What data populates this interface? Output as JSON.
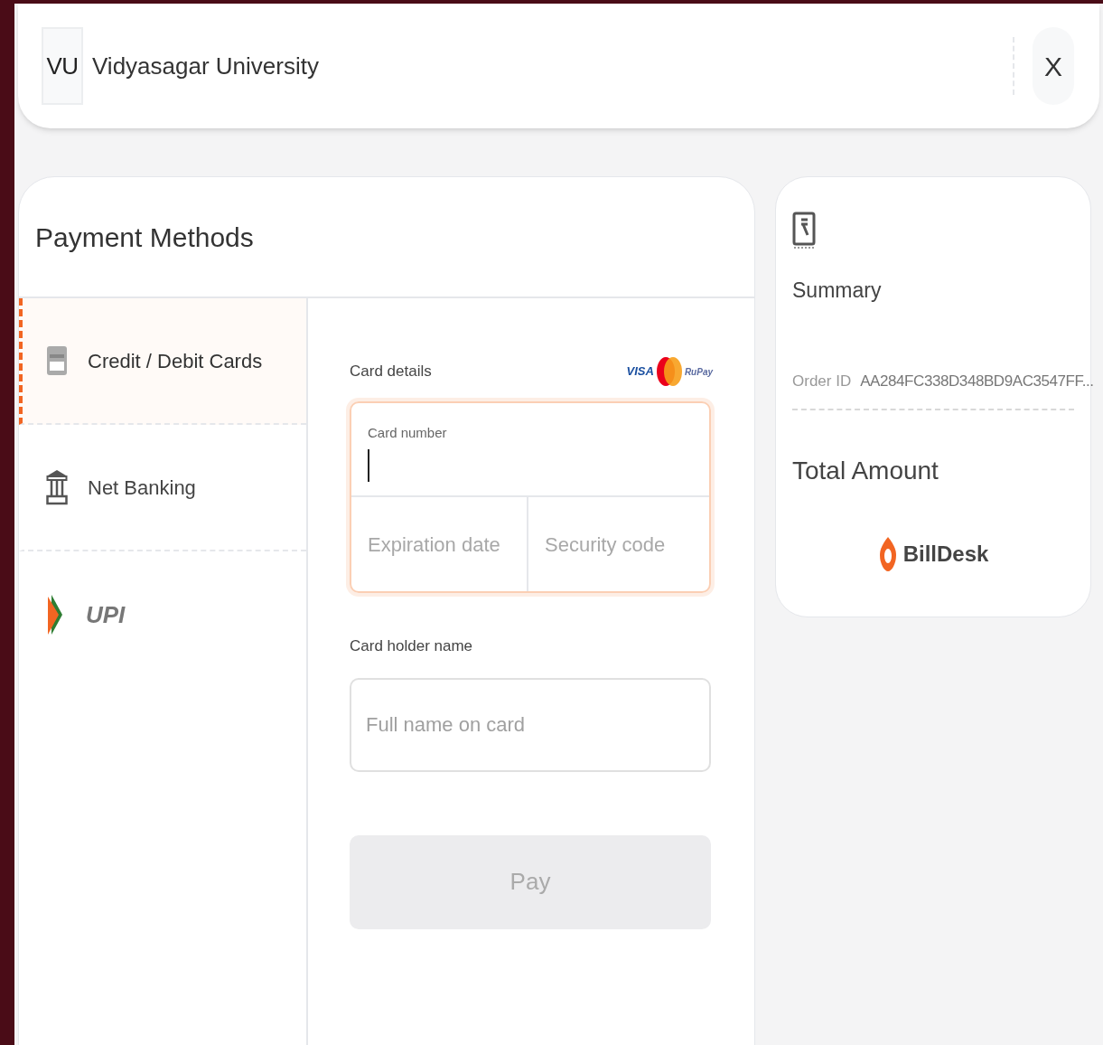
{
  "header": {
    "initials": "VU",
    "title": "Vidyasagar University",
    "close": "X"
  },
  "payment_methods": {
    "title": "Payment Methods",
    "items": [
      {
        "kind": "card",
        "label": "Credit / Debit Cards",
        "selected": true
      },
      {
        "kind": "netbanking",
        "label": "Net Banking",
        "selected": false
      },
      {
        "kind": "upi",
        "label": "UPI",
        "selected": false
      }
    ]
  },
  "card_form": {
    "section_label": "Card details",
    "networks": [
      "VISA",
      "RuPay"
    ],
    "card_number": {
      "label": "Card number"
    },
    "expiration": {
      "placeholder": "Expiration date"
    },
    "security": {
      "placeholder": "Security code"
    },
    "holder_label": "Card holder name",
    "holder": {
      "placeholder": "Full name on card"
    },
    "pay_button": {
      "label": "Pay",
      "disabled": true
    }
  },
  "summary": {
    "title": "Summary",
    "order_label": "Order ID",
    "order_id": "AA284FC338D348BD9AC3547FF...",
    "total_label": "Total Amount",
    "brand": "BillDesk"
  }
}
